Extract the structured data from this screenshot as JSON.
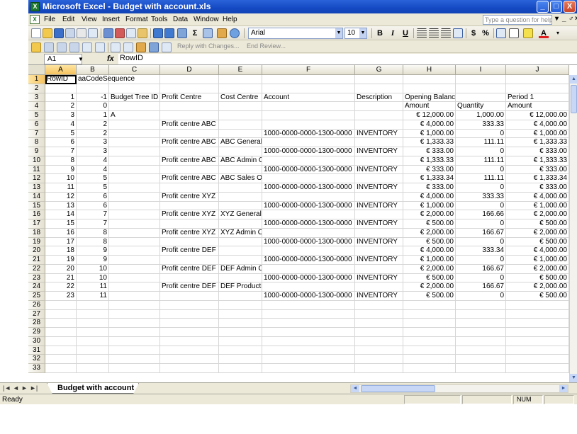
{
  "window": {
    "title": "Microsoft Excel - Budget with account.xls",
    "app_icon_glyph": "X",
    "minimize_glyph": "_",
    "maximize_glyph": "□",
    "close_glyph": "X"
  },
  "menu": {
    "items": [
      {
        "key": "file",
        "label": "File"
      },
      {
        "key": "edit",
        "label": "Edit"
      },
      {
        "key": "view",
        "label": "View"
      },
      {
        "key": "insert",
        "label": "Insert"
      },
      {
        "key": "format",
        "label": "Format"
      },
      {
        "key": "tools",
        "label": "Tools"
      },
      {
        "key": "data",
        "label": "Data"
      },
      {
        "key": "window",
        "label": "Window"
      },
      {
        "key": "help",
        "label": "Help"
      }
    ],
    "help_placeholder": "Type a question for help",
    "controls": [
      "▾",
      "_",
      "♂",
      "×"
    ]
  },
  "formatting": {
    "font_name": "Arial",
    "font_size": "10",
    "bold": "B",
    "italic": "I",
    "underline": "U",
    "currency": "$",
    "percent": "%"
  },
  "reviewing": {
    "reply_text": "Reply with Changes...",
    "end_review": "End Review..."
  },
  "formula_bar": {
    "name_box": "A1",
    "fx": "fx",
    "content": "RowID"
  },
  "columns": [
    "A",
    "B",
    "C",
    "D",
    "E",
    "F",
    "G",
    "H",
    "I",
    "J"
  ],
  "active_column": "A",
  "active_row": 1,
  "row_numbers": [
    1,
    2,
    3,
    4,
    5,
    6,
    7,
    8,
    9,
    10,
    11,
    12,
    13,
    14,
    15,
    16,
    17,
    18,
    19,
    20,
    21,
    22,
    23,
    24,
    25,
    26,
    27,
    28,
    29,
    30,
    31,
    32,
    33
  ],
  "rows": [
    {
      "A": "RowID",
      "B": "aaCodeSequence"
    },
    {},
    {
      "A": "1",
      "B": "-1",
      "C": "Budget Tree ID",
      "D": "Profit Centre",
      "E": "Cost Centre",
      "F": "Account",
      "G": "Description",
      "H": "Opening Balance",
      "J": "Period 1"
    },
    {
      "A": "2",
      "B": "0",
      "H": "Amount",
      "I": "Quantity",
      "J": "Amount"
    },
    {
      "A": "3",
      "B": "1",
      "C": "A",
      "H": "€ 12,000.00",
      "I": "1,000.00",
      "J": "€ 12,000.00"
    },
    {
      "A": "4",
      "B": "2",
      "D": "Profit centre ABC",
      "H": "€ 4,000.00",
      "I": "333.33",
      "J": "€ 4,000.00"
    },
    {
      "A": "5",
      "B": "2",
      "F": "1000-0000-0000-1300-0000",
      "G": "INVENTORY",
      "H": "€ 1,000.00",
      "I": "0",
      "J": "€ 1,000.00"
    },
    {
      "A": "6",
      "B": "3",
      "D": "Profit centre ABC",
      "E": "ABC General",
      "H": "€ 1,333.33",
      "I": "111.11",
      "J": "€ 1,333.33"
    },
    {
      "A": "7",
      "B": "3",
      "F": "1000-0000-0000-1300-0000",
      "G": "INVENTORY",
      "H": "€ 333.00",
      "I": "0",
      "J": "€ 333.00"
    },
    {
      "A": "8",
      "B": "4",
      "D": "Profit centre ABC",
      "E": "ABC Admin C",
      "H": "€ 1,333.33",
      "I": "111.11",
      "J": "€ 1,333.33"
    },
    {
      "A": "9",
      "B": "4",
      "F": "1000-0000-0000-1300-0000",
      "G": "INVENTORY",
      "H": "€ 333.00",
      "I": "0",
      "J": "€ 333.00"
    },
    {
      "A": "10",
      "B": "5",
      "D": "Profit centre ABC",
      "E": "ABC Sales O.",
      "H": "€ 1,333.34",
      "I": "111.11",
      "J": "€ 1,333.34"
    },
    {
      "A": "11",
      "B": "5",
      "F": "1000-0000-0000-1300-0000",
      "G": "INVENTORY",
      "H": "€ 333.00",
      "I": "0",
      "J": "€ 333.00"
    },
    {
      "A": "12",
      "B": "6",
      "D": "Profit centre XYZ",
      "H": "€ 4,000.00",
      "I": "333.33",
      "J": "€ 4,000.00"
    },
    {
      "A": "13",
      "B": "6",
      "F": "1000-0000-0000-1300-0000",
      "G": "INVENTORY",
      "H": "€ 1,000.00",
      "I": "0",
      "J": "€ 1,000.00"
    },
    {
      "A": "14",
      "B": "7",
      "D": "Profit centre XYZ",
      "E": "XYZ General (",
      "H": "€ 2,000.00",
      "I": "166.66",
      "J": "€ 2,000.00"
    },
    {
      "A": "15",
      "B": "7",
      "F": "1000-0000-0000-1300-0000",
      "G": "INVENTORY",
      "H": "€ 500.00",
      "I": "0",
      "J": "€ 500.00"
    },
    {
      "A": "16",
      "B": "8",
      "D": "Profit centre XYZ",
      "E": "XYZ Admin O.",
      "H": "€ 2,000.00",
      "I": "166.67",
      "J": "€ 2,000.00"
    },
    {
      "A": "17",
      "B": "8",
      "F": "1000-0000-0000-1300-0000",
      "G": "INVENTORY",
      "H": "€ 500.00",
      "I": "0",
      "J": "€ 500.00"
    },
    {
      "A": "18",
      "B": "9",
      "D": "Profit centre DEF",
      "H": "€ 4,000.00",
      "I": "333.34",
      "J": "€ 4,000.00"
    },
    {
      "A": "19",
      "B": "9",
      "F": "1000-0000-0000-1300-0000",
      "G": "INVENTORY",
      "H": "€ 1,000.00",
      "I": "0",
      "J": "€ 1,000.00"
    },
    {
      "A": "20",
      "B": "10",
      "D": "Profit centre DEF",
      "E": "DEF Admin C",
      "H": "€ 2,000.00",
      "I": "166.67",
      "J": "€ 2,000.00"
    },
    {
      "A": "21",
      "B": "10",
      "F": "1000-0000-0000-1300-0000",
      "G": "INVENTORY",
      "H": "€ 500.00",
      "I": "0",
      "J": "€ 500.00"
    },
    {
      "A": "22",
      "B": "11",
      "D": "Profit centre DEF",
      "E": "DEF Producti",
      "H": "€ 2,000.00",
      "I": "166.67",
      "J": "€ 2,000.00"
    },
    {
      "A": "23",
      "B": "11",
      "F": "1000-0000-0000-1300-0000",
      "G": "INVENTORY",
      "H": "€ 500.00",
      "I": "0",
      "J": "€ 500.00"
    },
    {},
    {},
    {},
    {},
    {},
    {},
    {},
    {}
  ],
  "sheet_tabs": [
    "Budget with account"
  ],
  "status": {
    "text": "Ready",
    "num": "NUM"
  },
  "colors": {
    "title_bar": "#1549c3",
    "chrome": "#ece9d8",
    "active_header": "#f7c25e"
  }
}
